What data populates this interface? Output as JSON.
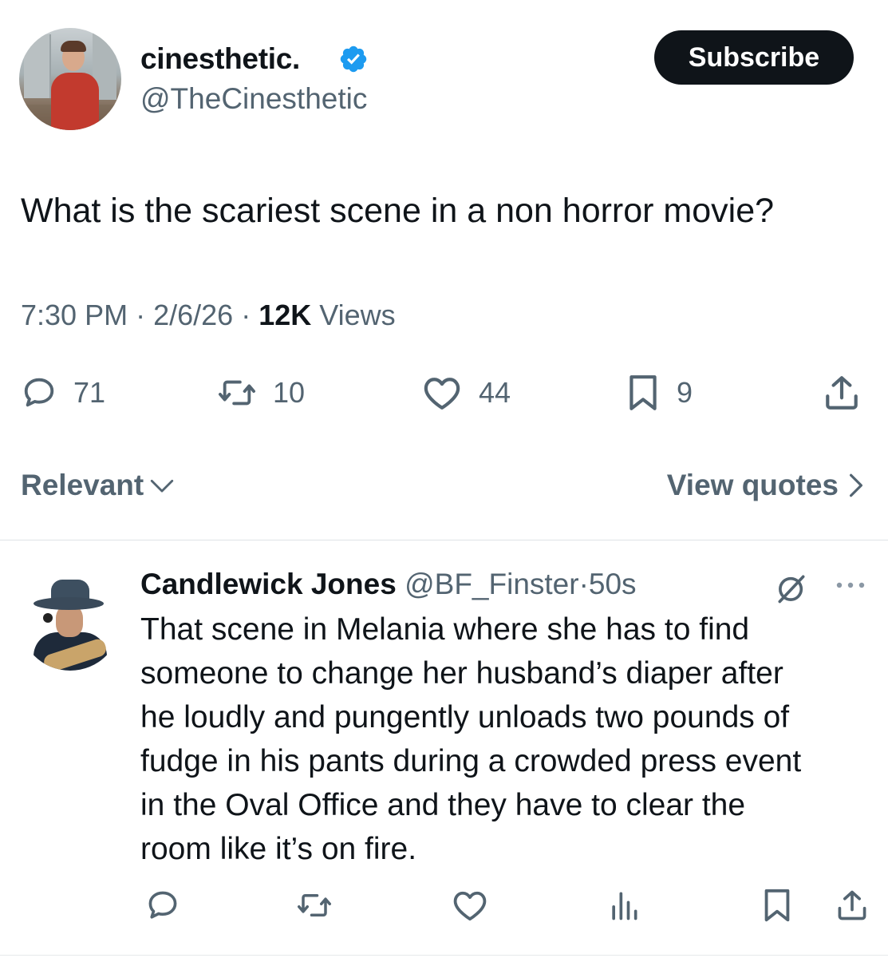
{
  "post": {
    "display_name": "cinesthetic.",
    "handle": "@TheCinesthetic",
    "verified": true,
    "subscribe_label": "Subscribe",
    "text": "What is the scariest scene in a non horror movie?",
    "time": "7:30 PM",
    "sep1": "·",
    "date": "2/6/26",
    "sep2": "·",
    "views_count": "12K",
    "views_label": "Views",
    "stats": {
      "replies": "71",
      "reposts": "10",
      "likes": "44",
      "bookmarks": "9"
    },
    "accent_color": "#1d9bf0"
  },
  "sort": {
    "relevant_label": "Relevant",
    "view_quotes_label": "View quotes"
  },
  "reply": {
    "display_name": "Candlewick Jones",
    "handle": "@BF_Finster",
    "sep": "·",
    "age": "50s",
    "lines": [
      "That scene in Melania where she has to find",
      "someone to change her husband’s diaper after",
      "he loudly and pungently unloads two pounds of",
      "fudge in his pants during a crowded press event",
      "in the Oval Office and they have to clear the",
      "room like it’s on fire."
    ]
  },
  "icons": {
    "verified": "verified-badge-icon",
    "reply": "speech-bubble-icon",
    "repost": "repost-arrows-icon",
    "like": "heart-icon",
    "bookmark": "bookmark-icon",
    "share": "share-upload-icon",
    "views": "bar-chart-icon",
    "grok": "grok-icon",
    "more": "ellipsis-icon"
  }
}
